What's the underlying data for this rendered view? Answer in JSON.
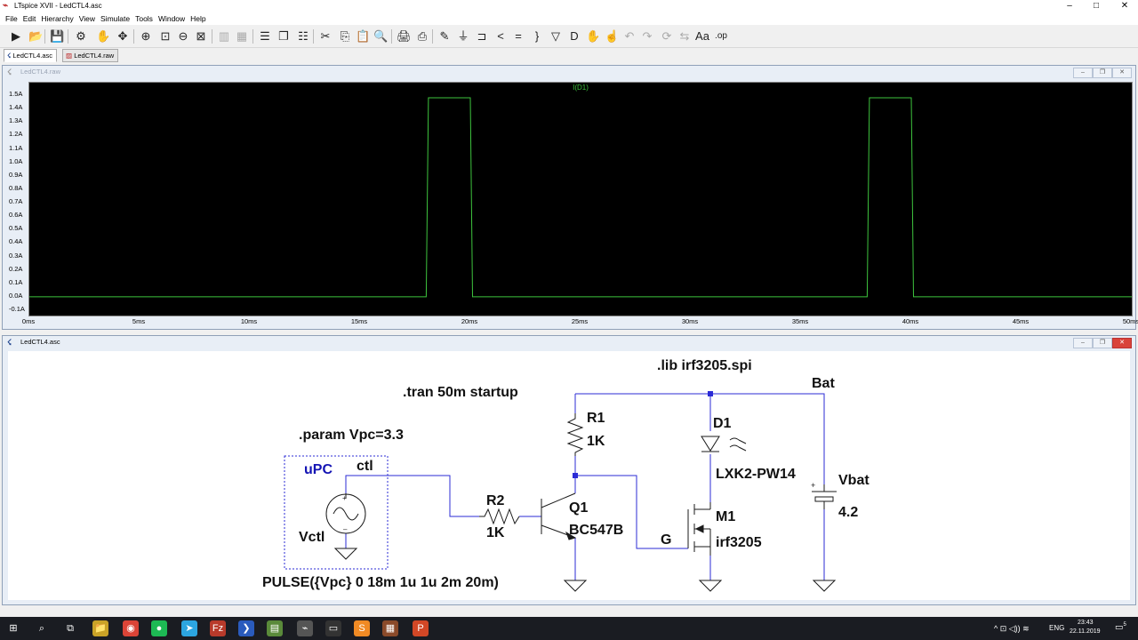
{
  "window": {
    "title": "LTspice XVII - LedCTL4.asc",
    "controls": {
      "minimize": "–",
      "maximize": "□",
      "close": "✕"
    }
  },
  "menu": [
    "File",
    "Edit",
    "Hierarchy",
    "View",
    "Simulate",
    "Tools",
    "Window",
    "Help"
  ],
  "toolbar": {
    "icons": [
      "run-icon",
      "open-icon",
      "save-icon",
      "control-panel-icon",
      "halt-icon",
      "pan-icon",
      "zoom-in-icon",
      "zoom-box-icon",
      "zoom-out-icon",
      "zoom-fit-icon",
      "autorange-icon",
      "grid-icon",
      "tile-horizontal-icon",
      "cascade-icon",
      "tile-vertical-icon",
      "cut-icon",
      "copy-icon",
      "paste-icon",
      "find-icon",
      "print-icon",
      "print-setup-icon",
      "wire-icon",
      "ground-icon",
      "label-icon",
      "resistor-icon",
      "capacitor-icon",
      "inductor-icon",
      "diode-icon",
      "component-icon",
      "move-icon",
      "drag-icon",
      "undo-icon",
      "redo-icon",
      "rotate-icon",
      "mirror-icon",
      "text-icon",
      "spice-directive-icon"
    ],
    "glyphs": [
      "▶",
      "📂",
      "💾",
      "⚙",
      "✋",
      "✥",
      "⊕",
      "⊡",
      "⊖",
      "⊠",
      "▥",
      "▦",
      "☰",
      "❐",
      "☷",
      "✂",
      "⎘",
      "📋",
      "🔍",
      "🖨",
      "⎙",
      "✎",
      "⏚",
      "⊐",
      "<",
      "=",
      "}",
      "▽",
      "D",
      "✋",
      "☝",
      "↶",
      "↷",
      "⟳",
      "⇆",
      "Aa",
      ".op"
    ]
  },
  "tabs": [
    {
      "label": "LedCTL4.asc",
      "active": true
    },
    {
      "label": "LedCTL4.raw",
      "active": false
    }
  ],
  "waveform_window": {
    "title": "LedCTL4.raw",
    "mdi_controls": [
      "–",
      "❐",
      "✕"
    ]
  },
  "schematic_window": {
    "title": "LedCTL4.asc",
    "mdi_controls": [
      "–",
      "❐",
      "✕"
    ]
  },
  "chart_data": {
    "type": "line",
    "title": "I(D1)",
    "xlabel": "",
    "ylabel": "",
    "xlim": [
      0,
      50
    ],
    "ylim": [
      -0.1,
      1.5
    ],
    "x_ticks": [
      "0ms",
      "5ms",
      "10ms",
      "15ms",
      "20ms",
      "25ms",
      "30ms",
      "35ms",
      "40ms",
      "45ms",
      "50ms"
    ],
    "y_ticks": [
      "1.5A",
      "1.4A",
      "1.3A",
      "1.2A",
      "1.1A",
      "1.0A",
      "0.9A",
      "0.8A",
      "0.7A",
      "0.6A",
      "0.5A",
      "0.4A",
      "0.3A",
      "0.2A",
      "0.1A",
      "0.0A",
      "-0.1A"
    ],
    "series": [
      {
        "name": "I(D1)",
        "color": "#3ec43e",
        "x": [
          0,
          18,
          18.1,
          20,
          20.1,
          38,
          38.1,
          40,
          40.1,
          50
        ],
        "y": [
          0,
          0,
          1.48,
          1.48,
          0,
          0,
          1.48,
          1.48,
          0,
          0
        ]
      }
    ],
    "grid": false,
    "background": "#000000"
  },
  "schematic": {
    "directives": {
      "lib": ".lib irf3205.spi",
      "tran": ".tran 50m startup",
      "param": ".param Vpc=3.3"
    },
    "source_label": "uPC",
    "source_name": "Vctl",
    "source_value": "PULSE({Vpc} 0 18m 1u 1u 2m 20m)",
    "net_ctl": "ctl",
    "net_bat": "Bat",
    "net_g": "G",
    "r1_name": "R1",
    "r1_value": "1K",
    "r2_name": "R2",
    "r2_value": "1K",
    "q1_name": "Q1",
    "q1_value": "BC547B",
    "d1_name": "D1",
    "d1_value": "LXK2-PW14",
    "m1_name": "M1",
    "m1_value": "irf3205",
    "vbat_name": "Vbat",
    "vbat_value": "4.2",
    "colors": {
      "wire": "#2b2bd6",
      "component": "#1a1a1a",
      "label_blue": "#1414b4"
    }
  },
  "taskbar": {
    "apps": [
      "windows-icon",
      "search-icon",
      "task-view-icon",
      "file-explorer-icon",
      "chrome-icon",
      "spotify-icon",
      "telegram-icon",
      "filezilla-icon",
      "powershell-icon",
      "notepad-icon",
      "ltspice-icon",
      "terminal-icon",
      "sublime-icon",
      "app-icon",
      "powerpoint-icon"
    ],
    "app_glyphs": [
      "⊞",
      "⌕",
      "⧉",
      "📁",
      "◉",
      "●",
      "➤",
      "Fz",
      "❯",
      "▤",
      "⌁",
      "▭",
      "S",
      "▦",
      "P"
    ],
    "language": "ENG",
    "time": "23:43",
    "date": "22.11.2019",
    "notif_count": "5"
  }
}
